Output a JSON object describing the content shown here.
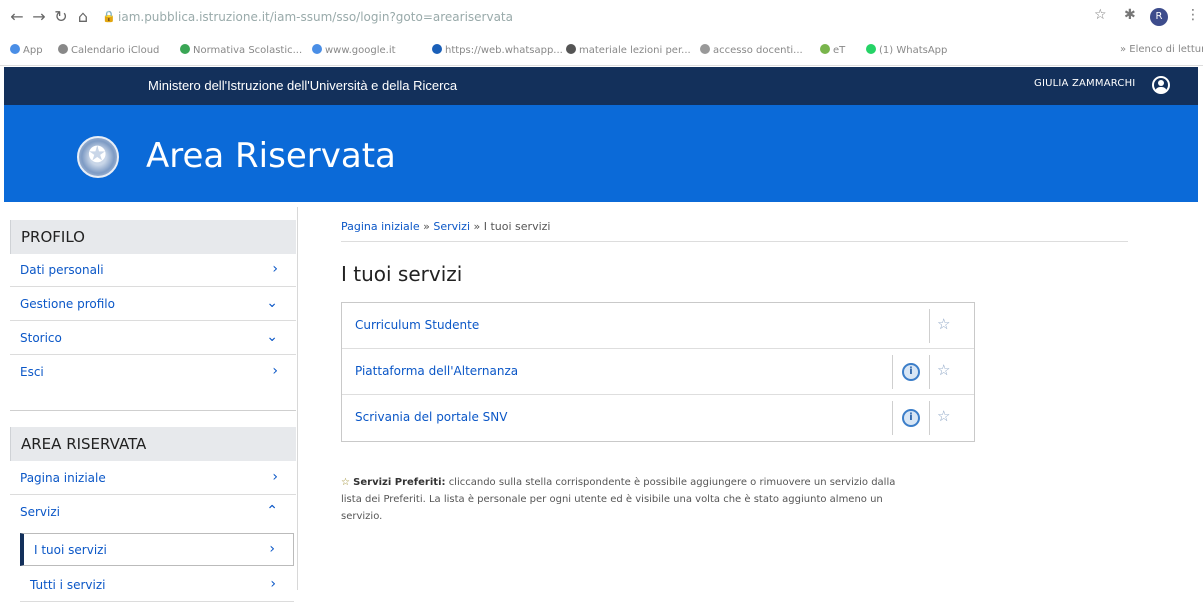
{
  "browser": {
    "url": "iam.pubblica.istruzione.it/iam-ssum/sso/login?goto=areariservata",
    "bookmarks": [
      {
        "label": "App",
        "color": "#4a8ee6"
      },
      {
        "label": "Calendario iCloud",
        "color": "#888888"
      },
      {
        "label": "Normativa Scolastic...",
        "color": "#3aa655"
      },
      {
        "label": "www.google.it",
        "color": "#4a8ee6"
      },
      {
        "label": "https://web.whatsapp...",
        "color": "#1a5fb8"
      },
      {
        "label": "materiale lezioni per...",
        "color": "#555555"
      },
      {
        "label": "accesso docenti...",
        "color": "#999999"
      },
      {
        "label": "eT",
        "color": "#79b54c"
      },
      {
        "label": "(1) WhatsApp",
        "color": "#25d366"
      }
    ],
    "other_bookmarks": "Elenco di lettura",
    "avatar_letter": "R"
  },
  "header": {
    "ministry": "Ministero dell'Istruzione dell'Università e della Ricerca",
    "user": "GIULIA ZAMMARCHI",
    "title": "Area Riservata"
  },
  "sidebar": {
    "profilo_title": "PROFILO",
    "profilo_items": [
      {
        "label": "Dati personali",
        "icon": "chevron-right"
      },
      {
        "label": "Gestione profilo",
        "icon": "chevron-down"
      },
      {
        "label": "Storico",
        "icon": "chevron-down"
      },
      {
        "label": "Esci",
        "icon": "chevron-right"
      }
    ],
    "area_title": "AREA RISERVATA",
    "area_items": [
      {
        "label": "Pagina iniziale",
        "icon": "chevron-right"
      },
      {
        "label": "Servizi",
        "icon": "chevron-up"
      }
    ],
    "sub_items": [
      {
        "label": "I tuoi servizi",
        "icon": "chevron-right"
      },
      {
        "label": "Tutti i servizi",
        "icon": "chevron-right"
      }
    ]
  },
  "main": {
    "breadcrumb": {
      "home": "Pagina iniziale",
      "sep1": "»",
      "section": "Servizi",
      "sep2": "»",
      "current": "I tuoi servizi"
    },
    "title": "I tuoi servizi",
    "services": [
      {
        "name": "Curriculum Studente",
        "info": false
      },
      {
        "name": "Piattaforma dell'Alternanza",
        "info": true
      },
      {
        "name": "Scrivania del portale SNV",
        "info": true
      }
    ],
    "note_bold": "Servizi Preferiti:",
    "note_text": "cliccando sulla stella corrispondente è possibile aggiungere o rimuovere un servizio dalla lista dei Preferiti. La lista è personale per ogni utente ed è visibile una volta che è stato aggiunto almeno un servizio."
  },
  "colors": {
    "gov_bar": "#13305b",
    "banner": "#0b6ad8",
    "link": "#0b57c7"
  }
}
